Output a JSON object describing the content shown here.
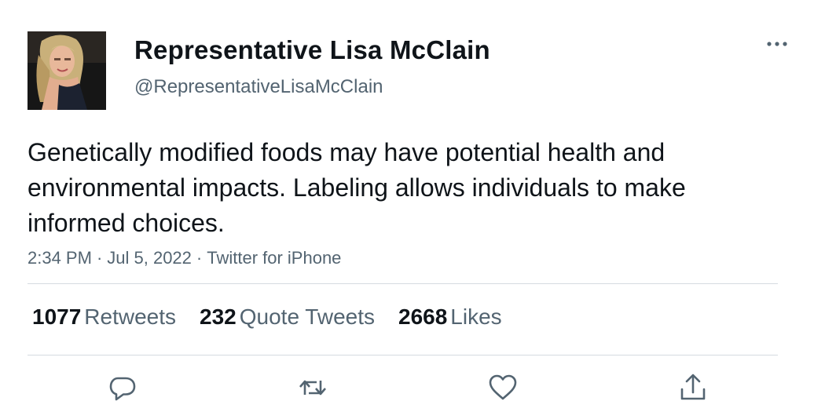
{
  "author": {
    "display_name": "Representative Lisa McClain",
    "handle": "@RepresentativeLisaMcClain",
    "avatar_icon": "profile-photo"
  },
  "tweet": {
    "text": "Genetically modified foods may have potential health and environmental impacts. Labeling allows individuals to make informed choices.",
    "time": "2:34 PM",
    "date": "Jul 5, 2022",
    "separator": "·",
    "source": "Twitter for iPhone"
  },
  "stats": {
    "retweets": {
      "count": "1077",
      "label": "Retweets"
    },
    "quotes": {
      "count": "232",
      "label": "Quote Tweets"
    },
    "likes": {
      "count": "2668",
      "label": "Likes"
    }
  },
  "icons": {
    "more": "more-horizontal-icon",
    "reply": "reply-icon",
    "retweet": "retweet-icon",
    "like": "heart-icon",
    "share": "share-icon"
  },
  "colors": {
    "text": "#0f1419",
    "secondary": "#536471",
    "divider": "#d5dbe0"
  }
}
